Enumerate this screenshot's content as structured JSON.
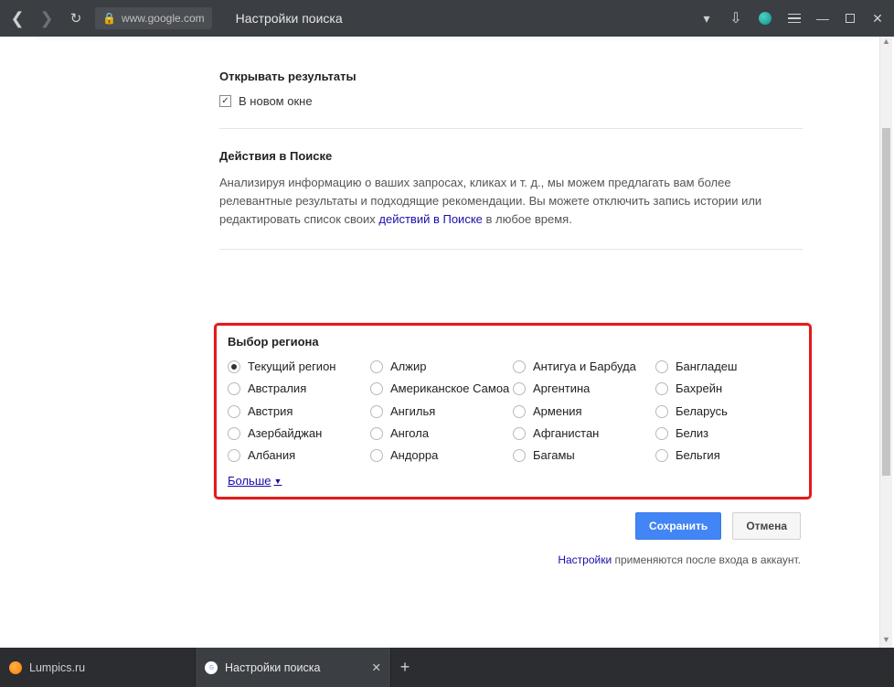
{
  "toolbar": {
    "url": "www.google.com",
    "page_title": "Настройки поиска"
  },
  "results": {
    "heading": "Открывать результаты",
    "checkbox_label": "В новом окне",
    "checked": true
  },
  "activity": {
    "heading": "Действия в Поиске",
    "text_before_link": "Анализируя информацию о ваших запросах, кликах и т. д., мы можем предлагать вам более релевантные результаты и подходящие рекомендации. Вы можете отключить запись истории или редактировать список своих ",
    "link_text": "действий в Поиске",
    "text_after_link": " в любое время."
  },
  "region": {
    "heading": "Выбор региона",
    "more_label": "Больше",
    "columns": [
      [
        "Текущий регион",
        "Австралия",
        "Австрия",
        "Азербайджан",
        "Албания"
      ],
      [
        "Алжир",
        "Американское Самоа",
        "Ангилья",
        "Ангола",
        "Андорра"
      ],
      [
        "Антигуа и Барбуда",
        "Аргентина",
        "Армения",
        "Афганистан",
        "Багамы"
      ],
      [
        "Бангладеш",
        "Бахрейн",
        "Беларусь",
        "Белиз",
        "Бельгия"
      ]
    ],
    "selected": "Текущий регион"
  },
  "buttons": {
    "save": "Сохранить",
    "cancel": "Отмена"
  },
  "apply_note": {
    "link": "Настройки",
    "text": " применяются после входа в аккаунт."
  },
  "tabs": [
    {
      "label": "Lumpics.ru",
      "icon": "lump",
      "active": false
    },
    {
      "label": "Настройки поиска",
      "icon": "google",
      "active": true
    }
  ]
}
